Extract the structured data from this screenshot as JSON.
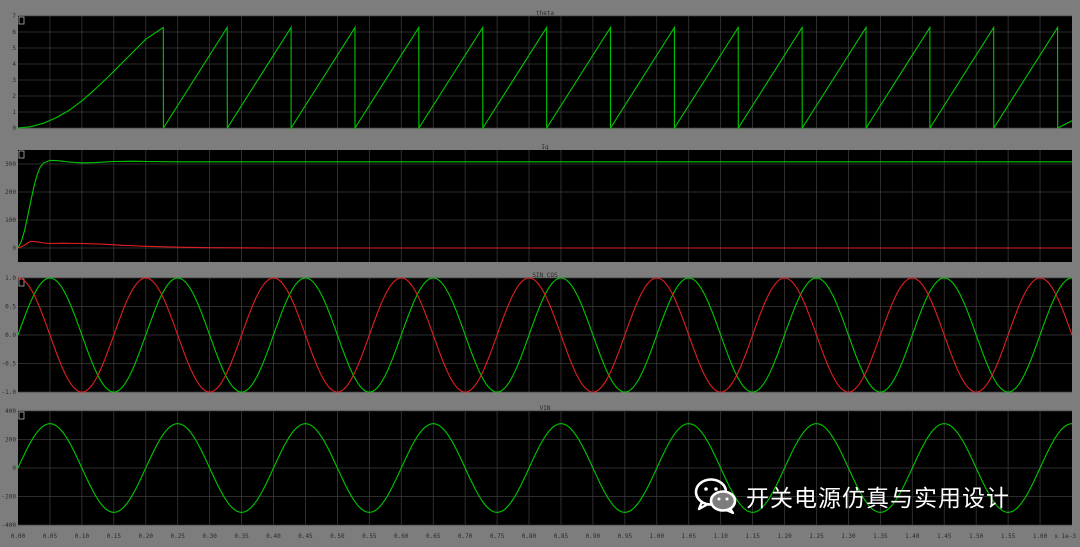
{
  "chart_data": [
    {
      "type": "line",
      "title": "theta",
      "xlim": [
        0,
        1.65
      ],
      "ylim": [
        0,
        7
      ],
      "yticks": [
        "0",
        "1",
        "2",
        "3",
        "4",
        "5",
        "6",
        "7"
      ],
      "grid": true,
      "series": [
        {
          "color": "#00c800",
          "x": [
            0,
            0.02,
            0.04,
            0.06,
            0.08,
            0.1,
            0.12,
            0.14,
            0.16,
            0.18,
            0.2,
            0.2275,
            0.2276,
            0.3275,
            0.3276,
            0.4275,
            0.4276,
            0.5275,
            0.5276,
            0.6275,
            0.6276,
            0.7275,
            0.7276,
            0.8275,
            0.8276,
            0.9275,
            0.9276,
            1.0275,
            1.0276,
            1.1275,
            1.1276,
            1.2275,
            1.2276,
            1.3275,
            1.3276,
            1.4275,
            1.4276,
            1.5275,
            1.5276,
            1.6275,
            1.6276,
            1.65
          ],
          "y": [
            0,
            0.08,
            0.3,
            0.65,
            1.1,
            1.7,
            2.4,
            3.15,
            3.95,
            4.75,
            5.55,
            6.28,
            0,
            6.28,
            0,
            6.28,
            0,
            6.28,
            0,
            6.28,
            0,
            6.28,
            0,
            6.28,
            0,
            6.28,
            0,
            6.28,
            0,
            6.28,
            0,
            6.28,
            0,
            6.28,
            0,
            6.28,
            0,
            6.28,
            0,
            6.28,
            0,
            0.45
          ]
        }
      ]
    },
    {
      "type": "line",
      "title": "Iq",
      "xlim": [
        0,
        1.65
      ],
      "ylim": [
        -50,
        350
      ],
      "yticks": [
        "0",
        "100",
        "200",
        "300"
      ],
      "grid": true,
      "series": [
        {
          "color": "#00c800",
          "x": [
            0,
            0.005,
            0.01,
            0.015,
            0.02,
            0.025,
            0.03,
            0.035,
            0.04,
            0.05,
            0.06,
            0.08,
            0.1,
            0.12,
            0.15,
            0.18,
            0.2,
            0.25,
            0.3,
            0.35,
            1.65
          ],
          "y": [
            0,
            22,
            60,
            112,
            168,
            220,
            262,
            290,
            304,
            313,
            312,
            307,
            304,
            305,
            309,
            310,
            309,
            308,
            308,
            308,
            308
          ]
        },
        {
          "color": "#e02020",
          "x": [
            0,
            0.005,
            0.01,
            0.015,
            0.02,
            0.03,
            0.04,
            0.05,
            0.07,
            0.1,
            0.13,
            0.16,
            0.2,
            0.25,
            0.3,
            0.4,
            0.5,
            1.65
          ],
          "y": [
            0,
            4,
            10,
            18,
            24,
            22,
            18,
            16,
            17,
            16,
            14,
            10,
            6,
            3,
            1,
            0,
            0,
            0
          ]
        }
      ]
    },
    {
      "type": "line",
      "title": "SIN COS",
      "xlim": [
        0,
        1.65
      ],
      "ylim": [
        -1,
        1
      ],
      "yticks": [
        "-1.0",
        "-0.5",
        "0.0",
        "0.5",
        "1.0"
      ],
      "grid": true,
      "series": [
        {
          "color": "#00c800",
          "function": "sin",
          "period": 0.2,
          "theta_ref": 0
        },
        {
          "color": "#e02020",
          "function": "cos",
          "period": 0.2,
          "theta_ref": 0
        }
      ]
    },
    {
      "type": "line",
      "title": "VIN",
      "xlim": [
        0,
        1.65
      ],
      "ylim": [
        -400,
        400
      ],
      "yticks": [
        "-400",
        "-200",
        "0",
        "200",
        "400"
      ],
      "grid": true,
      "series": [
        {
          "color": "#00c800",
          "function": "sin",
          "period": 0.2,
          "amplitude": 311
        }
      ]
    }
  ],
  "x_axis": {
    "ticks": [
      "0.00",
      "0.05",
      "0.10",
      "0.15",
      "0.20",
      "0.25",
      "0.30",
      "0.35",
      "0.40",
      "0.45",
      "0.50",
      "0.55",
      "0.60",
      "0.65",
      "0.70",
      "0.75",
      "0.80",
      "0.85",
      "0.90",
      "0.95",
      "1.00",
      "1.05",
      "1.10",
      "1.15",
      "1.20",
      "1.25",
      "1.30",
      "1.35",
      "1.40",
      "1.45",
      "1.50",
      "1.55",
      "1.60"
    ],
    "unit_label": "x 1e-3"
  },
  "colors": {
    "plot_bg": "#000000",
    "frame_bg": "#7d7d7d",
    "grid": "#3a3a3a",
    "green": "#00c800",
    "red": "#e02020",
    "text": "#2b2b2b"
  },
  "watermark": {
    "text": "开关电源仿真与实用设计",
    "icon": "wechat-icon"
  }
}
